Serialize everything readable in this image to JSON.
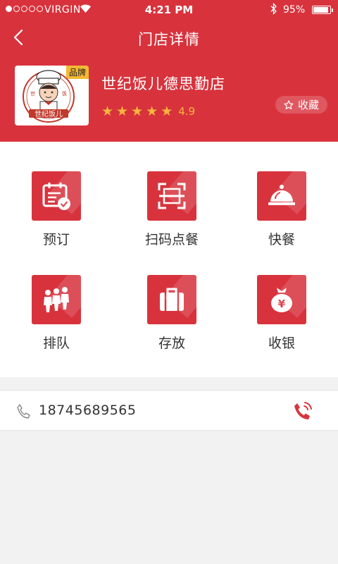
{
  "status": {
    "carrier": "VIRGIN",
    "time": "4:21 PM",
    "battery": "95%"
  },
  "nav": {
    "title": "门店详情"
  },
  "store": {
    "name": "世纪饭儿德思勤店",
    "badge": "品牌",
    "logo_text": "世纪饭儿",
    "rating": "4.9",
    "stars": 5,
    "favorite_label": "收藏"
  },
  "services": [
    {
      "label": "预订",
      "icon": "calendar-check-icon"
    },
    {
      "label": "扫码点餐",
      "icon": "scan-icon"
    },
    {
      "label": "快餐",
      "icon": "cloche-icon"
    },
    {
      "label": "排队",
      "icon": "queue-people-icon"
    },
    {
      "label": "存放",
      "icon": "luggage-icon"
    },
    {
      "label": "收银",
      "icon": "money-bag-icon"
    }
  ],
  "contact": {
    "phone": "18745689565"
  },
  "colors": {
    "brand": "#d8333d",
    "star": "#f6b73c",
    "badge": "#f4b934"
  }
}
